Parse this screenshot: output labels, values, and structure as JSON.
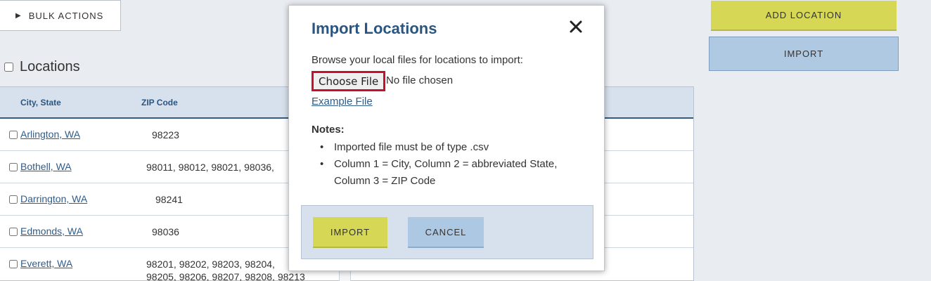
{
  "toolbar": {
    "bulk_actions_label": "BULK ACTIONS",
    "add_location_label": "ADD LOCATION",
    "import_label": "IMPORT"
  },
  "locations": {
    "title": "Locations",
    "columns": [
      "City, State",
      "ZIP Code"
    ],
    "rows": [
      {
        "city": "Arlington, WA",
        "zip": "98223"
      },
      {
        "city": "Bothell, WA",
        "zip": "98011, 98012, 98021, 98036,"
      },
      {
        "city": "Darrington, WA",
        "zip": "98241"
      },
      {
        "city": "Edmonds, WA",
        "zip": "98036"
      },
      {
        "city": "Everett, WA",
        "zip": "98201, 98202, 98203, 98204,",
        "zip2": "98205, 98206, 98207, 98208, 98213"
      }
    ]
  },
  "modal": {
    "title": "Import Locations",
    "browse_text": "Browse your local files for locations to import:",
    "choose_file_label": "Choose File",
    "no_file_text": "No file chosen",
    "example_link": "Example File",
    "notes_label": "Notes:",
    "notes": [
      "Imported file must be of type .csv",
      "Column 1 = City, Column 2 = abbreviated State, Column 3 = ZIP Code"
    ],
    "import_label": "IMPORT",
    "cancel_label": "CANCEL"
  },
  "colors": {
    "accent_yellow": "#d6d755",
    "accent_blue": "#b0c9e3",
    "title_blue": "#2a5580",
    "highlight_red": "#c8102e"
  },
  "icons": {
    "bulk_toggle": "triangle-right-icon",
    "close": "close-icon"
  }
}
